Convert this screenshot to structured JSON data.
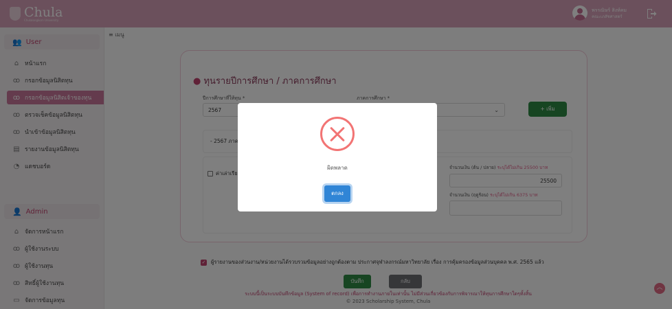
{
  "topbar": {
    "logo_text": "Chula",
    "logo_sub": "Chulalongkorn University",
    "user_name": "พรรณิษร์ สิงห์คม",
    "user_role": "คณะเภสัชศาสตร์",
    "avatar_icon": "user-circle-icon",
    "logout_icon": "logout-icon"
  },
  "sidebar": {
    "user_section": "User",
    "user_items": [
      {
        "label": "หน้าแรก",
        "icon": "home-icon"
      },
      {
        "label": "กรอกข้อมูลนิสิตทุน",
        "icon": "user-icon"
      },
      {
        "label": "กรอกข้อมูลนิสิตเจ้าของทุน",
        "icon": "user-icon"
      },
      {
        "label": "ตรวจเช็คข้อมูลนิสิตทุน",
        "icon": "user-icon"
      },
      {
        "label": "นำเข้าข้อมูลนิสิตทุน",
        "icon": "user-icon"
      },
      {
        "label": "รายงานข้อมูลนิสิตทุน",
        "icon": "report-icon"
      },
      {
        "label": "แดชบอร์ด",
        "icon": "dashboard-icon"
      }
    ],
    "admin_section": "Admin",
    "admin_items": [
      {
        "label": "จัดการหน้าแรก",
        "icon": "home-icon"
      },
      {
        "label": "ผู้ใช้งานระบบ",
        "icon": "user-icon"
      },
      {
        "label": "ผู้ใช้งานทุน",
        "icon": "user-icon"
      },
      {
        "label": "สิทธิ์ผู้ใช้งานทุน",
        "icon": "user-icon"
      },
      {
        "label": "จัดการข้อมูลทุน",
        "icon": "folder-icon"
      }
    ]
  },
  "main": {
    "menu_label": "≡ เมนู",
    "card_title": "ทุนรายปีการศึกษา / ภาคการศึกษา",
    "year_label": "ปีการศึกษาที่ให้ทุน *",
    "year_value": "2567",
    "term_label": "ภาคการศึกษา *",
    "term_value": "",
    "add_button": "+ เพิ่ม",
    "item_row_text": "- 2567 ภาคต้น",
    "expense_label": "ค่าเล่าเรียน",
    "amount_label": "จำนวนเงิน (ต้น / ปลาย)",
    "amount_hint": "ระบุได้ไม่เกิน 25500 บาท",
    "amount_value": "25500",
    "summer_label": "จำนวนเงิน (ฤดูร้อน)",
    "summer_hint": "ระบุได้ไม่เกิน 6375 บาท",
    "summer_value": "",
    "consent_text": "ผู้รายงานของส่วนงาน/หน่วยงานได้รวบรวมข้อมูลอย่างถูกต้องตาม ประกาศจุฬาลงกรณ์มหาวิทยาลัย เรื่อง การคุ้มครองข้อมูลส่วนบุคคล พ.ศ. 2565 แล้ว",
    "save_button": "บันทึก",
    "back_button": "กลับ",
    "footer_line1": "ระบบนี้เป็นระบบบันทึกข้อมูล (System of record) เพื่อการทำงานภายในเท่านั้น ไม่มีส่วนเกี่ยวข้องกับการพิจารณาให้ทุนการศึกษาใดๆทั้งสิ้น",
    "footer_line2": "© 2023 Scholarship System, Chula"
  },
  "modal": {
    "icon": "error-x-icon",
    "message": "ผิดพลาด",
    "ok_button": "ตกลง"
  }
}
